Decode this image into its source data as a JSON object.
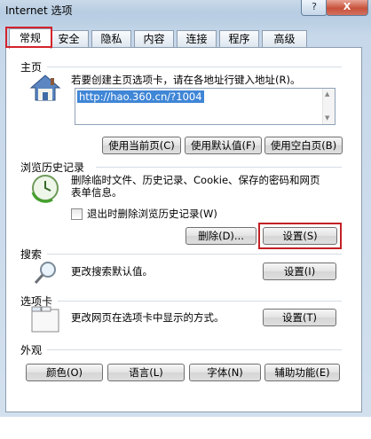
{
  "window": {
    "title": "Internet 选项",
    "help": "?",
    "close": "X"
  },
  "tabs": [
    "常规",
    "安全",
    "隐私",
    "内容",
    "连接",
    "程序",
    "高级"
  ],
  "homepage": {
    "title": "主页",
    "description": "若要创建主页选项卡，请在各地址行键入地址(R)。",
    "url": "http://hao.360.cn/?1004",
    "buttons": [
      "使用当前页(C)",
      "使用默认值(F)",
      "使用空白页(B)"
    ]
  },
  "history": {
    "title": "浏览历史记录",
    "description_line1": "删除临时文件、历史记录、Cookie、保存的密码和网页",
    "description_line2": "表单信息。",
    "checkbox_label": "退出时删除浏览历史记录(W)",
    "delete_button": "删除(D)...",
    "settings_button": "设置(S)"
  },
  "search": {
    "title": "搜索",
    "description": "更改搜索默认值。",
    "settings_button": "设置(I)"
  },
  "tabs_section": {
    "title": "选项卡",
    "description": "更改网页在选项卡中显示的方式。",
    "settings_button": "设置(T)"
  },
  "appearance": {
    "title": "外观",
    "buttons": [
      "颜色(O)",
      "语言(L)",
      "字体(N)",
      "辅助功能(E)"
    ]
  },
  "colors": {
    "highlight": "#d3232b",
    "selection": "#3f86d6"
  }
}
